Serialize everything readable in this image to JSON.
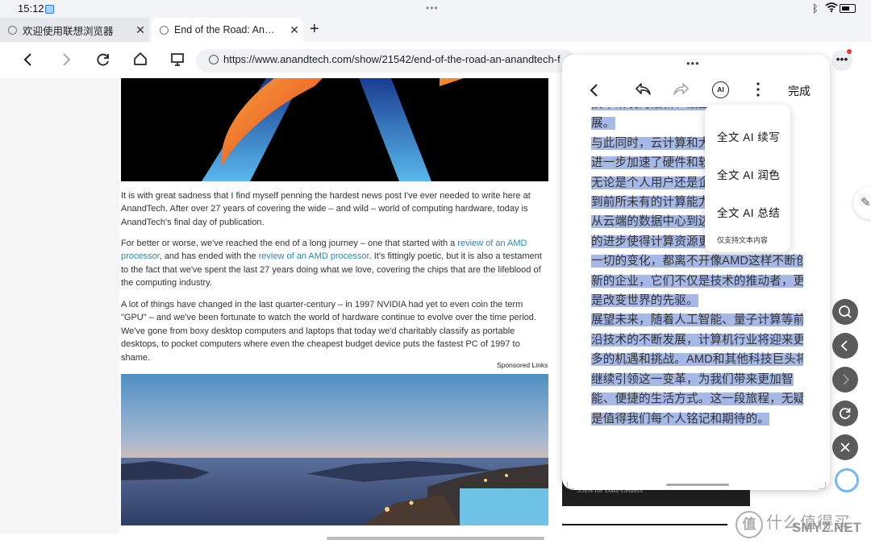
{
  "status_bar": {
    "time": "15:12"
  },
  "tabs": [
    {
      "label": "欢迎使用联想浏览器",
      "active": false
    },
    {
      "label": "End of the Road: An…",
      "active": true
    }
  ],
  "new_tab_icon": "plus-icon",
  "address": {
    "url": "https://www.anandtech.com/show/21542/end-of-the-road-an-anandtech-f"
  },
  "article": {
    "p1": "It is with great sadness that I find myself penning the hardest news post I've ever needed to write here at AnandTech. After over 27 years of covering the wide – and wild – world of computing hardware, today is AnandTech's final day of publication.",
    "p2_a": "For better or worse, we've reached the end of a long journey – one that started with a ",
    "p2_link1": "review of an AMD processor",
    "p2_b": ", and has ended with the ",
    "p2_link2": "review of an AMD processor",
    "p2_c": ". It's fittingly poetic, but it is also a testament to the fact that we've spent the last 27 years doing what we love, covering the chips that are the lifeblood of the computing industry.",
    "p3": "A lot of things have changed in the last quarter-century – in 1997 NVIDIA had yet to even coin the term \"GPU\" – and we've been fortunate to watch the world of hardware continue to evolve over the time period. We've gone from boxy desktop computers and laptops that today we'd charitably classify as portable desktops, to pocket computers where even the cheapest budget device puts the fastest PC of 1997 to shame.",
    "sponsored": "Sponsored Links"
  },
  "side_ad": {
    "text": "SSDs for Data Centers"
  },
  "float_window": {
    "done_label": "完成",
    "ai_icon_label": "AI",
    "lines": [
      "技术研发的最新、最直接的驱动力",
      "展。",
      "与此同时，云计算和大数据的兴起",
      "进一步加速了硬件和软件的发展。",
      "无论是个人用户还是企业用户，都得",
      "到前所未有的计算能力和存储能力",
      "从云端的数据中心到边缘的设备，",
      "的进步使得计算资源更加普及。这",
      "一切的变化，都离不开像AMD这样不断创",
      "新的企业，它们不仅是技术的推动者，更",
      "是改变世界的先驱。",
      "展望未来，随着人工智能、量子计算等前",
      "沿技术的不断发展，计算机行业将迎来更",
      "多的机遇和挑战。AMD和其他科技巨头将",
      "继续引领这一变革，为我们带来更加智",
      "能、便捷的生活方式。这一段旅程，无疑",
      "是值得我们每个人铭记和期待的。"
    ]
  },
  "ai_menu": {
    "items": [
      "全文 AI 续写",
      "全文 AI 润色",
      "全文 AI 总结"
    ],
    "note": "仅支持文本内容"
  },
  "watermark": {
    "brand": "什么值得买",
    "site": "SMYZ.NET"
  },
  "colors": {
    "link": "#1f8fb5",
    "selection": "#a6b8e6",
    "notification_dot": "#e53935"
  }
}
